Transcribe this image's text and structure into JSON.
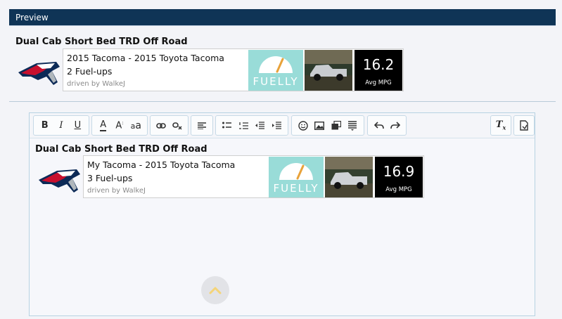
{
  "preview": {
    "title": "Preview"
  },
  "signature_preview": {
    "title": "Dual Cab Short Bed TRD Off Road",
    "card": {
      "line1": "2015 Tacoma - 2015 Toyota Tacoma",
      "line2": "2 Fuel-ups",
      "line3": "driven by WalkeJ",
      "brand": "FUELLY",
      "mpg_value": "16.2",
      "mpg_label": "Avg MPG"
    }
  },
  "editor": {
    "toolbar_icons": [
      "bold-icon",
      "italic-icon",
      "underline-icon",
      "font-color-icon",
      "font-size-icon",
      "font-family-icon",
      "link-icon",
      "unlink-icon",
      "align-icon",
      "bullet-list-icon",
      "numbered-list-icon",
      "outdent-icon",
      "indent-icon",
      "smilie-icon",
      "image-icon",
      "media-icon",
      "insert-icon",
      "undo-icon",
      "redo-icon",
      "remove-format-icon",
      "toggle-bbcode-icon"
    ],
    "content": {
      "title": "Dual Cab Short Bed TRD Off Road",
      "card": {
        "line1": "My Tacoma - 2015 Toyota Tacoma",
        "line2": "3 Fuel-ups",
        "line3": "driven by WalkeJ",
        "brand": "FUELLY",
        "mpg_value": "16.9",
        "mpg_label": "Avg MPG"
      }
    }
  },
  "colors": {
    "header_bg": "#0f3456",
    "fuelly_bg": "#99dcd8",
    "editor_border": "#b7d2e2"
  }
}
